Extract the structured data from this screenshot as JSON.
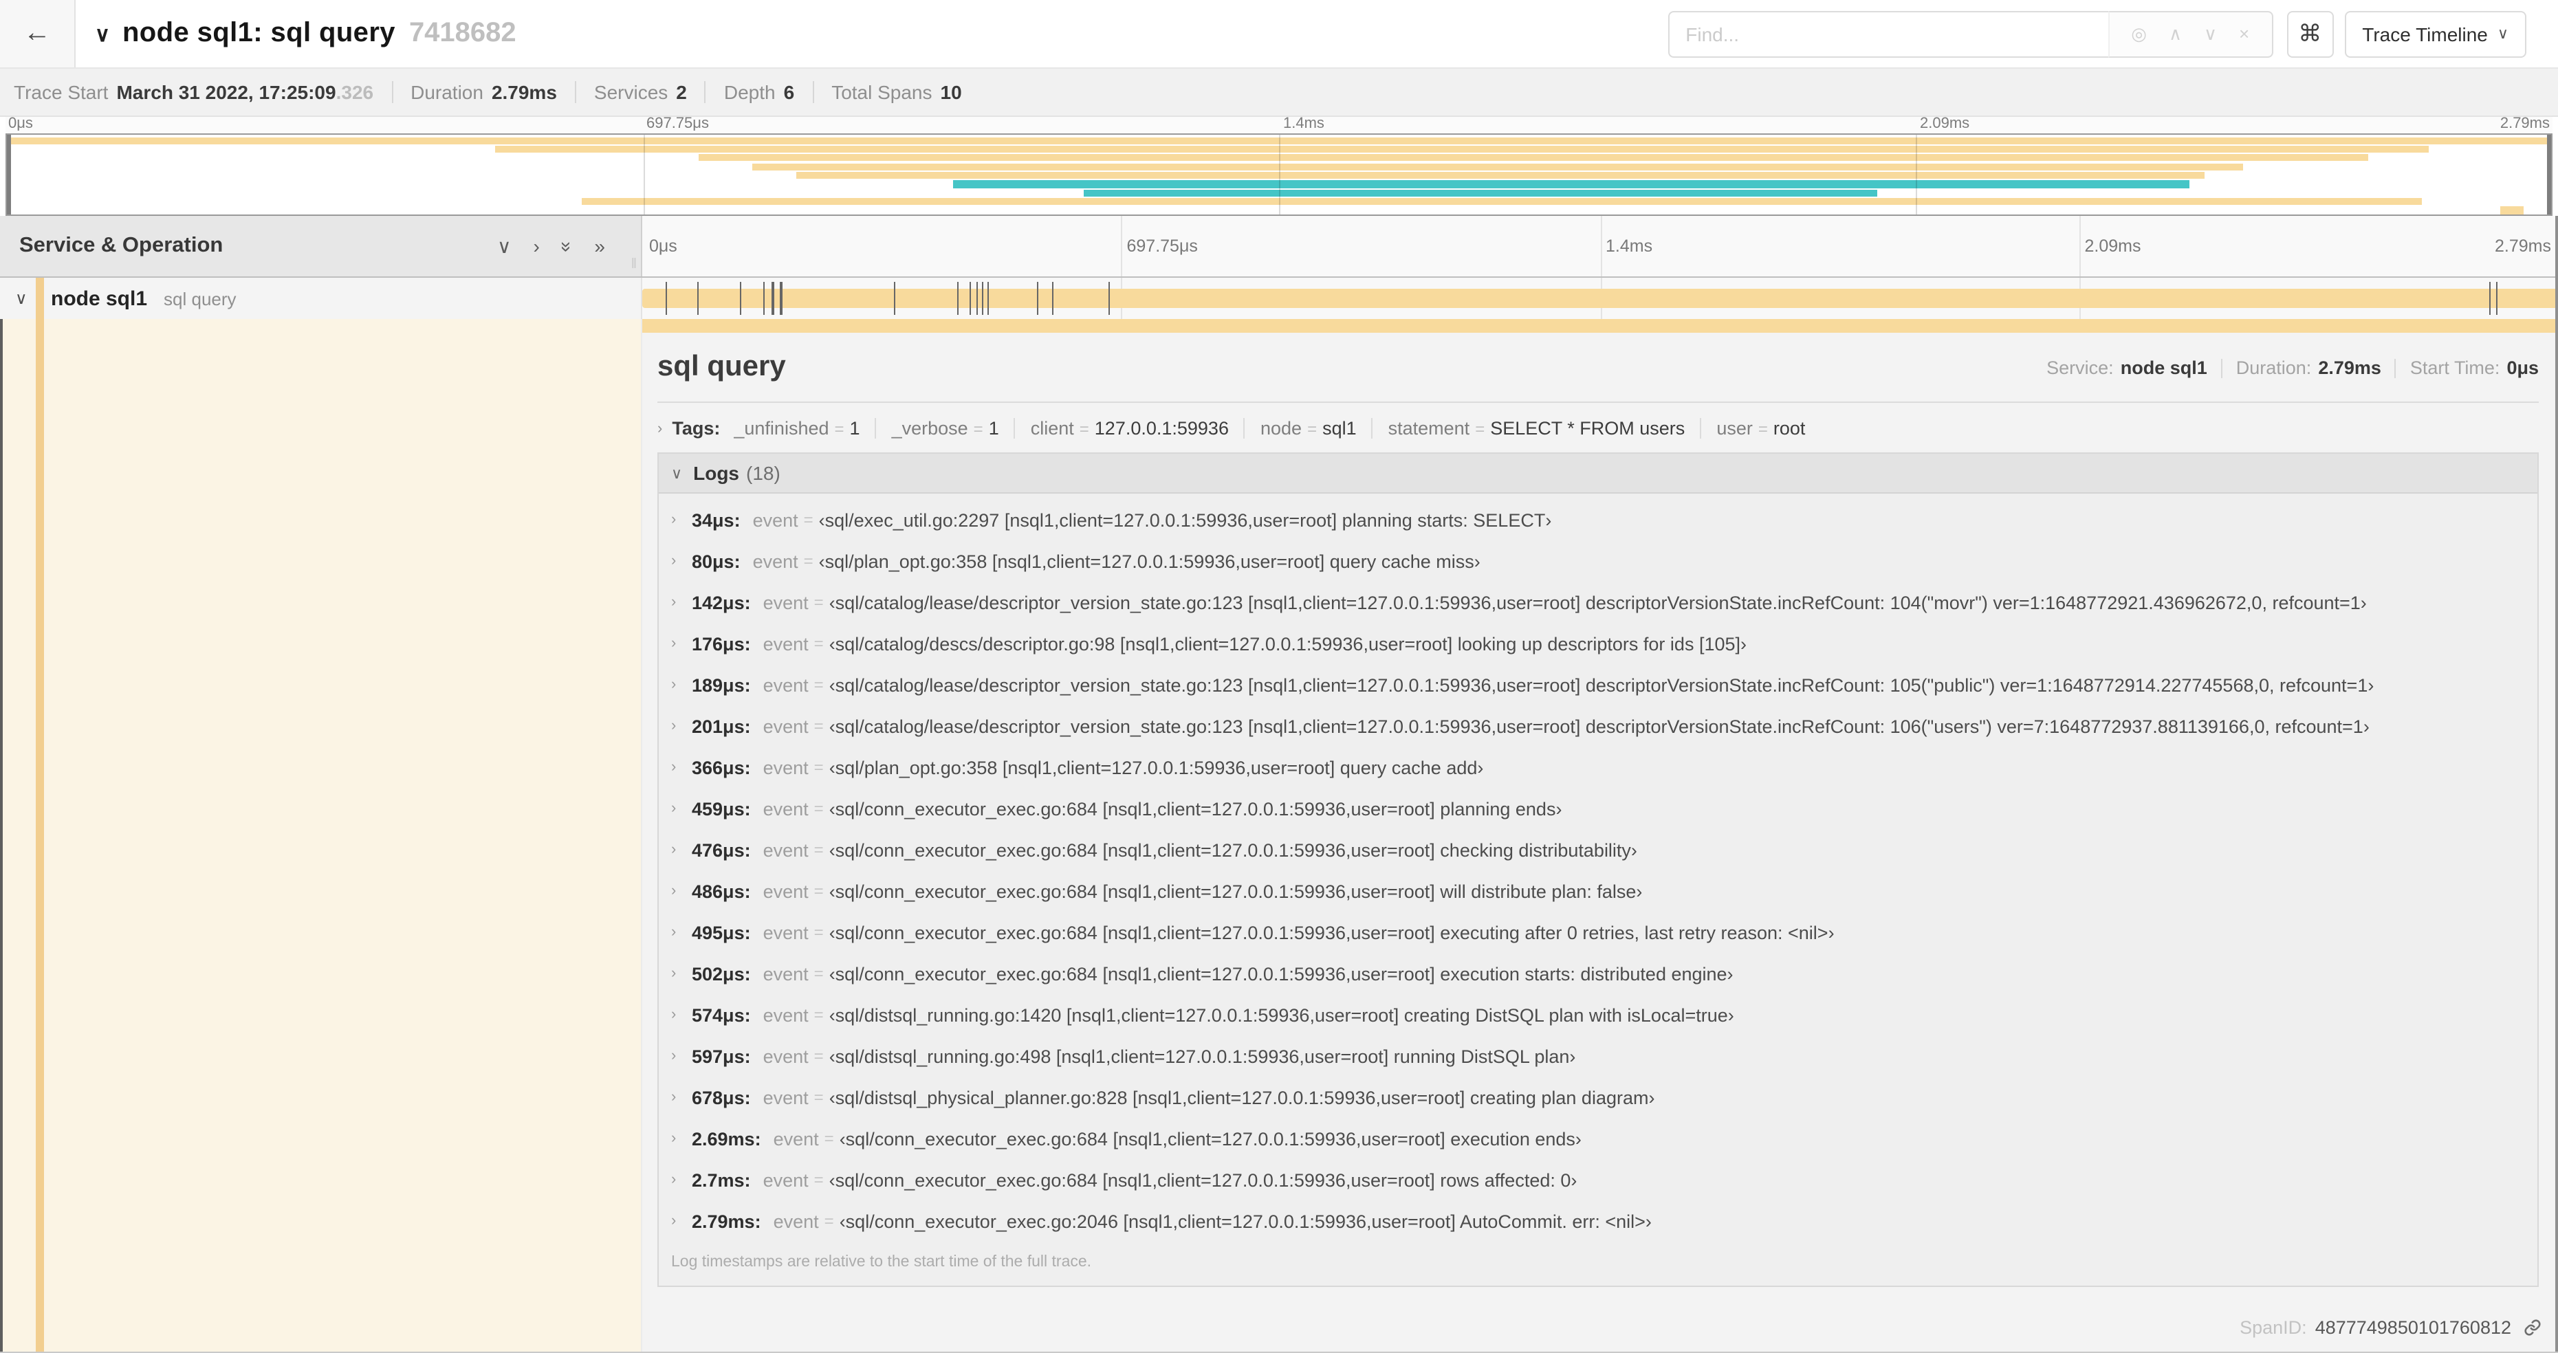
{
  "header": {
    "back_icon": "←",
    "collapse_icon": "∨",
    "title": "node sql1: sql query",
    "trace_id": "7418682",
    "find_placeholder": "Find...",
    "find_icons": [
      {
        "name": "locate-icon",
        "glyph": "◎"
      },
      {
        "name": "prev-result-icon",
        "glyph": "∧"
      },
      {
        "name": "next-result-icon",
        "glyph": "∨"
      },
      {
        "name": "clear-search-icon",
        "glyph": "×"
      }
    ],
    "shortcut_button": "⌘",
    "view_selector": "Trace Timeline",
    "view_caret": "∨"
  },
  "trace_stats": {
    "items": [
      {
        "label": "Trace Start",
        "value": "March 31 2022, 17:25:09",
        "muted_suffix": ".326"
      },
      {
        "label": "Duration",
        "value": "2.79ms"
      },
      {
        "label": "Services",
        "value": "2"
      },
      {
        "label": "Depth",
        "value": "6"
      },
      {
        "label": "Total Spans",
        "value": "10"
      }
    ]
  },
  "colors": {
    "orange": "#F8DA9C",
    "teal": "#45C5C6",
    "strip_orange": "#F2CE8F"
  },
  "trace_duration_us": 2790,
  "minimap": {
    "tick_labels": [
      "0μs",
      "697.75μs",
      "1.4ms",
      "2.09ms",
      "2.79ms"
    ],
    "grid_percents": [
      25,
      50,
      75
    ],
    "rows": [
      {
        "start": 0,
        "end": 100,
        "color": "orange"
      },
      {
        "start": 19.2,
        "end": 95.2,
        "color": "orange"
      },
      {
        "start": 27.2,
        "end": 92.8,
        "color": "orange"
      },
      {
        "start": 29.3,
        "end": 87.9,
        "color": "orange"
      },
      {
        "start": 31.0,
        "end": 86.4,
        "color": "orange"
      },
      {
        "start": 37.2,
        "end": 85.8,
        "color": "teal"
      },
      {
        "start": 42.3,
        "end": 73.5,
        "color": "teal"
      },
      {
        "start": 22.6,
        "end": 94.9,
        "color": "orange"
      },
      {
        "start": 98.0,
        "end": 98.9,
        "color": "orange"
      }
    ]
  },
  "timeline": {
    "left_header": "Service & Operation",
    "collapse_icons": [
      {
        "name": "collapse-one-icon",
        "glyph": "∨",
        "rotated": false
      },
      {
        "name": "expand-one-icon",
        "glyph": "›",
        "rotated": false
      },
      {
        "name": "collapse-all-icon",
        "glyph": "»",
        "rotated": true
      },
      {
        "name": "expand-all-icon",
        "glyph": "»",
        "rotated": false
      }
    ],
    "grip": "‖",
    "ruler_labels": [
      "0μs",
      "697.75μs",
      "1.4ms",
      "2.09ms",
      "2.79ms"
    ],
    "span_row": {
      "collapse_icon": "∨",
      "service": "node sql1",
      "operation": "sql query",
      "bar_start_pct": 0,
      "bar_end_pct": 100
    }
  },
  "detail": {
    "title": "sql query",
    "summary": [
      {
        "label": "Service:",
        "value": "node sql1"
      },
      {
        "label": "Duration:",
        "value": "2.79ms"
      },
      {
        "label": "Start Time:",
        "value": "0μs"
      }
    ],
    "kv_separator": "=",
    "tags": {
      "expander": "›",
      "label": "Tags:",
      "items": [
        {
          "key": "_unfinished",
          "value": "1"
        },
        {
          "key": "_verbose",
          "value": "1"
        },
        {
          "key": "client",
          "value": "127.0.0.1:59936"
        },
        {
          "key": "node",
          "value": "sql1"
        },
        {
          "key": "statement",
          "value": "SELECT * FROM users"
        },
        {
          "key": "user",
          "value": "root"
        }
      ]
    },
    "logs": {
      "expander": "∨",
      "label": "Logs",
      "count_display": "(18)",
      "row_expander": "›",
      "field": "event",
      "entries": [
        {
          "time": "34μs:",
          "t_us": 34,
          "value": "‹sql/exec_util.go:2297 [nsql1,client=127.0.0.1:59936,user=root] planning starts: SELECT›"
        },
        {
          "time": "80μs:",
          "t_us": 80,
          "value": "‹sql/plan_opt.go:358 [nsql1,client=127.0.0.1:59936,user=root] query cache miss›"
        },
        {
          "time": "142μs:",
          "t_us": 142,
          "value": "‹sql/catalog/lease/descriptor_version_state.go:123 [nsql1,client=127.0.0.1:59936,user=root] descriptorVersionState.incRefCount: 104(\"movr\") ver=1:1648772921.436962672,0, refcount=1›"
        },
        {
          "time": "176μs:",
          "t_us": 176,
          "value": "‹sql/catalog/descs/descriptor.go:98 [nsql1,client=127.0.0.1:59936,user=root] looking up descriptors for ids [105]›"
        },
        {
          "time": "189μs:",
          "t_us": 189,
          "value": "‹sql/catalog/lease/descriptor_version_state.go:123 [nsql1,client=127.0.0.1:59936,user=root] descriptorVersionState.incRefCount: 105(\"public\") ver=1:1648772914.227745568,0, refcount=1›"
        },
        {
          "time": "201μs:",
          "t_us": 201,
          "value": "‹sql/catalog/lease/descriptor_version_state.go:123 [nsql1,client=127.0.0.1:59936,user=root] descriptorVersionState.incRefCount: 106(\"users\") ver=7:1648772937.881139166,0, refcount=1›"
        },
        {
          "time": "366μs:",
          "t_us": 366,
          "value": "‹sql/plan_opt.go:358 [nsql1,client=127.0.0.1:59936,user=root] query cache add›"
        },
        {
          "time": "459μs:",
          "t_us": 459,
          "value": "‹sql/conn_executor_exec.go:684 [nsql1,client=127.0.0.1:59936,user=root] planning ends›"
        },
        {
          "time": "476μs:",
          "t_us": 476,
          "value": "‹sql/conn_executor_exec.go:684 [nsql1,client=127.0.0.1:59936,user=root] checking distributability›"
        },
        {
          "time": "486μs:",
          "t_us": 486,
          "value": "‹sql/conn_executor_exec.go:684 [nsql1,client=127.0.0.1:59936,user=root] will distribute plan: false›"
        },
        {
          "time": "495μs:",
          "t_us": 495,
          "value": "‹sql/conn_executor_exec.go:684 [nsql1,client=127.0.0.1:59936,user=root] executing after 0 retries, last retry reason: <nil>›"
        },
        {
          "time": "502μs:",
          "t_us": 502,
          "value": "‹sql/conn_executor_exec.go:684 [nsql1,client=127.0.0.1:59936,user=root] execution starts: distributed engine›"
        },
        {
          "time": "574μs:",
          "t_us": 574,
          "value": "‹sql/distsql_running.go:1420 [nsql1,client=127.0.0.1:59936,user=root] creating DistSQL plan with isLocal=true›"
        },
        {
          "time": "597μs:",
          "t_us": 597,
          "value": "‹sql/distsql_running.go:498 [nsql1,client=127.0.0.1:59936,user=root] running DistSQL plan›"
        },
        {
          "time": "678μs:",
          "t_us": 678,
          "value": "‹sql/distsql_physical_planner.go:828 [nsql1,client=127.0.0.1:59936,user=root] creating plan diagram›"
        },
        {
          "time": "2.69ms:",
          "t_us": 2690,
          "value": "‹sql/conn_executor_exec.go:684 [nsql1,client=127.0.0.1:59936,user=root] execution ends›"
        },
        {
          "time": "2.7ms:",
          "t_us": 2700,
          "value": "‹sql/conn_executor_exec.go:684 [nsql1,client=127.0.0.1:59936,user=root] rows affected: 0›"
        },
        {
          "time": "2.79ms:",
          "t_us": 2790,
          "value": "‹sql/conn_executor_exec.go:2046 [nsql1,client=127.0.0.1:59936,user=root] AutoCommit. err: <nil>›"
        }
      ],
      "footer": "Log timestamps are relative to the start time of the full trace."
    },
    "span_id": {
      "label": "SpanID:",
      "value": "4877749850101760812"
    }
  }
}
